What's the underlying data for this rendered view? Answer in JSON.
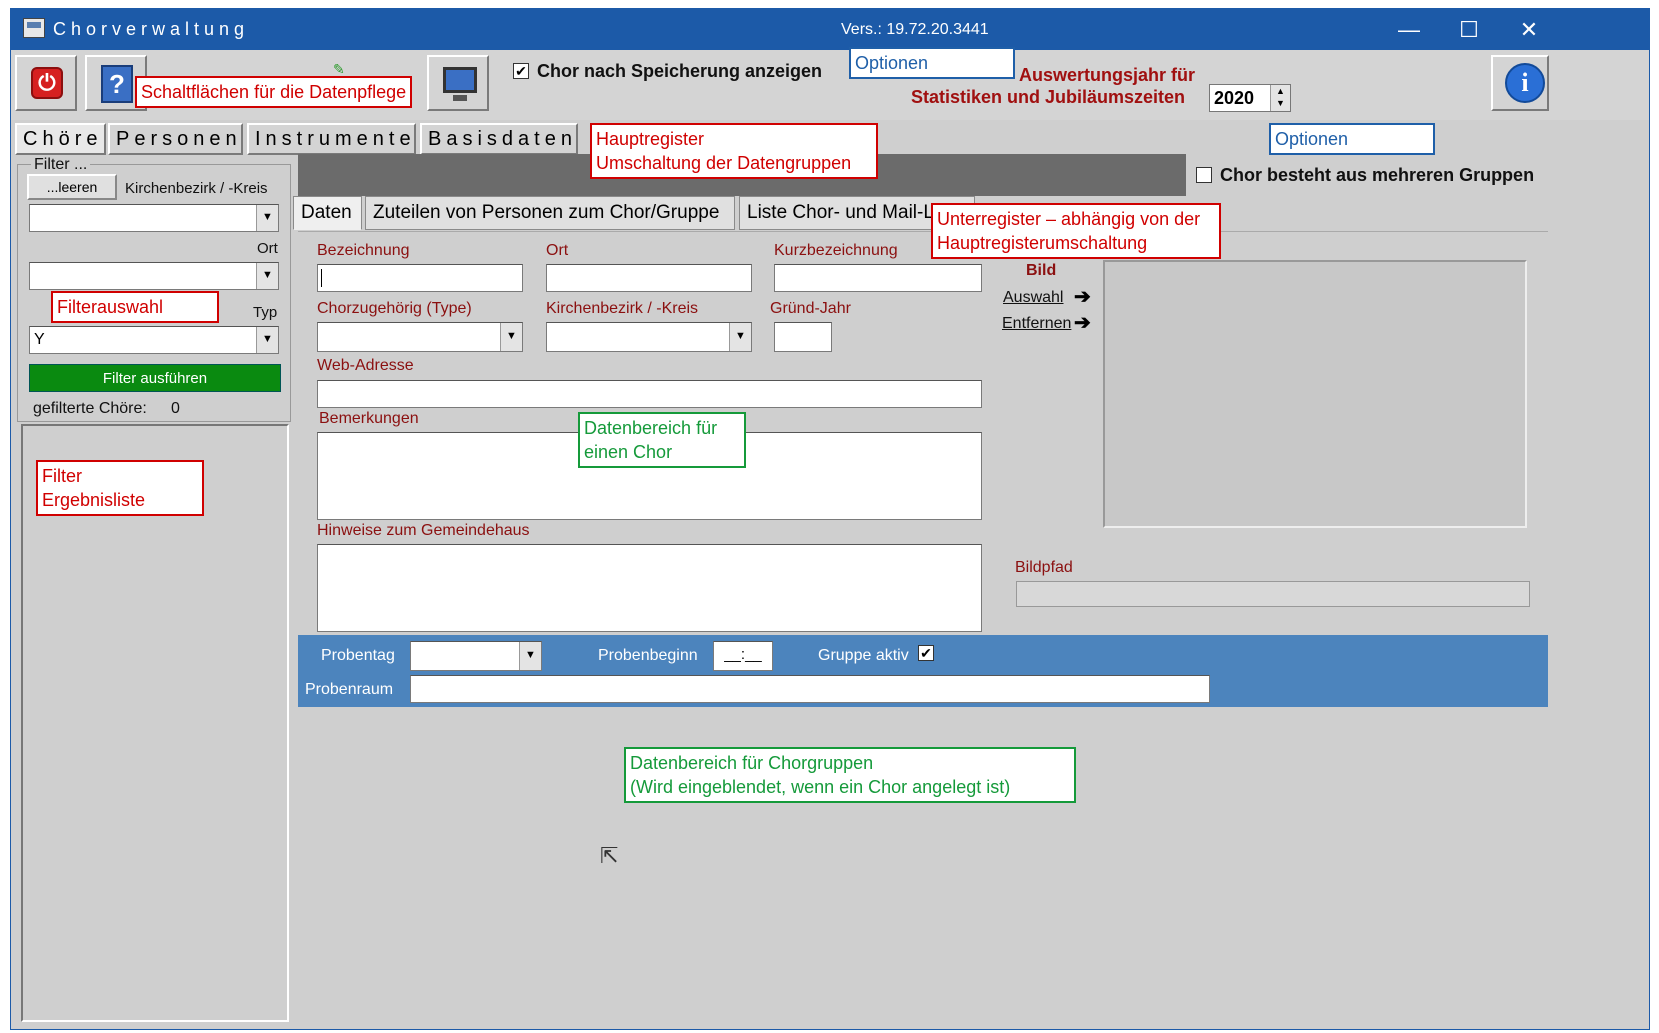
{
  "window": {
    "title": "Chorverwaltung",
    "version": "Vers.: 19.72.20.3441",
    "controls": {
      "minimize": "—",
      "maximize": "☐",
      "close": "✕"
    }
  },
  "toolbar": {
    "show_after_save_label": "Chor nach Speicherung anzeigen",
    "show_after_save_checked": "✔",
    "year_label_line1": "Auswertungsjahr für",
    "year_label_line2": "Statistiken und Jubiläumszeiten",
    "year_value": "2020",
    "icons": [
      "power-icon",
      "help-icon",
      "monitor-icon",
      "info-icon"
    ]
  },
  "main_tabs": [
    "Chöre",
    "Personen",
    "Instrumente",
    "Basisdaten"
  ],
  "filter": {
    "group_title": "Filter ...",
    "clear_button": "...leeren",
    "district_label": "Kirchenbezirk / -Kreis",
    "district_value": "",
    "place_label": "Ort",
    "place_value": "",
    "type_label": "Typ",
    "type_value": "Y",
    "run_button": "Filter ausführen",
    "count_label": "gefilterte Chöre:",
    "count_value": "0"
  },
  "options": {
    "multi_group_label": "Chor besteht aus mehreren Gruppen"
  },
  "sub_tabs": [
    "Daten",
    "Zuteilen von Personen zum Chor/Gruppe",
    "Liste Chor- und Mail-L"
  ],
  "form": {
    "name_label": "Bezeichnung",
    "place_label": "Ort",
    "short_label": "Kurzbezeichnung",
    "type_label": "Chorzugehörig (Type)",
    "district_label": "Kirchenbezirk / -Kreis",
    "founded_label": "Gründ-Jahr",
    "web_label": "Web-Adresse",
    "remarks_label": "Bemerkungen",
    "hints_label": "Hinweise zum Gemeindehaus",
    "image_label": "Bild",
    "select_link": "Auswahl",
    "remove_link": "Entfernen",
    "image_path_label": "Bildpfad"
  },
  "group": {
    "rehearsal_day_label": "Probentag",
    "rehearsal_start_label": "Probenbeginn",
    "rehearsal_start_value": "__:__",
    "active_label": "Gruppe aktiv",
    "active_checked": "✔",
    "room_label": "Probenraum"
  },
  "annotations": {
    "buttons": "Schaltflächen für die Datenpflege",
    "options_top": "Optionen",
    "main_register_line1": "Hauptregister",
    "main_register_line2": "Umschaltung der Datengruppen",
    "options_right": "Optionen",
    "sub_register_line1": "Unterregister – abhängig von der",
    "sub_register_line2": "Hauptregisterumschaltung",
    "filter_selection": "Filterauswahl",
    "filter_results_line1": "Filter",
    "filter_results_line2": "Ergebnisliste",
    "choir_data_line1": "Datenbereich für",
    "choir_data_line2": "einen Chor",
    "group_data_line1": "Datenbereich für Chorgruppen",
    "group_data_line2": "(Wird eingeblendet, wenn ein Chor angelegt ist)"
  },
  "colors": {
    "titlebar": "#1c5aa8",
    "annotation_red": "#d00000",
    "annotation_blue": "#1f5fa8",
    "annotation_green": "#159a3a",
    "filter_button": "#0a8a10",
    "group_bar": "#4c84bd",
    "label_darkred": "#8b1010"
  }
}
